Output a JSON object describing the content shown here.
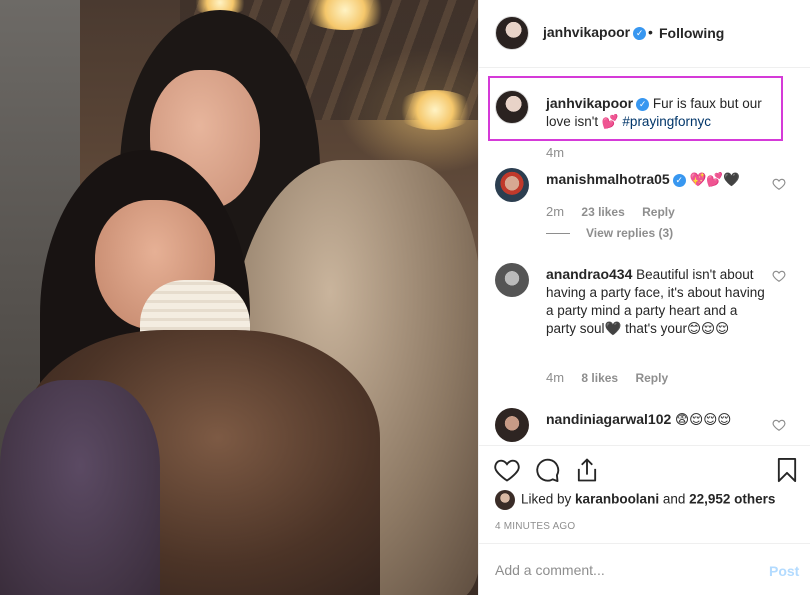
{
  "post": {
    "author": "janhvikapoor",
    "separator": "•",
    "follow_state": "Following",
    "verified_mark": "✓"
  },
  "caption": {
    "username": "janhvikapoor",
    "text": "Fur is faux but our love isn't 💕 ",
    "hashtag": "#prayingfornyc",
    "time": "4m"
  },
  "comments": [
    {
      "username": "manishmalhotra05",
      "text": "💖💕🖤",
      "time": "2m",
      "likes": "23 likes",
      "reply": "Reply",
      "view_replies": "View replies (3)"
    },
    {
      "username": "anandrao434",
      "text": "Beautiful isn't about having a party face, it's about having a party mind a party heart and a party soul🖤 that's your😊😌😌",
      "time": "4m",
      "likes": "8 likes",
      "reply": "Reply"
    },
    {
      "username": "nandiniagarwal102",
      "text": "😨😌😌😌"
    }
  ],
  "liked_by": {
    "prefix": "Liked by ",
    "user": "karanboolani",
    "middle": " and ",
    "others": "22,952 others"
  },
  "timestamp": "4 MINUTES AGO",
  "add_comment": {
    "placeholder": "Add a comment...",
    "post_label": "Post"
  },
  "colors": {
    "verified": "#3897f0",
    "highlight": "#d53ad8",
    "hashtag": "#003569",
    "post_disabled": "#b3dbff"
  }
}
